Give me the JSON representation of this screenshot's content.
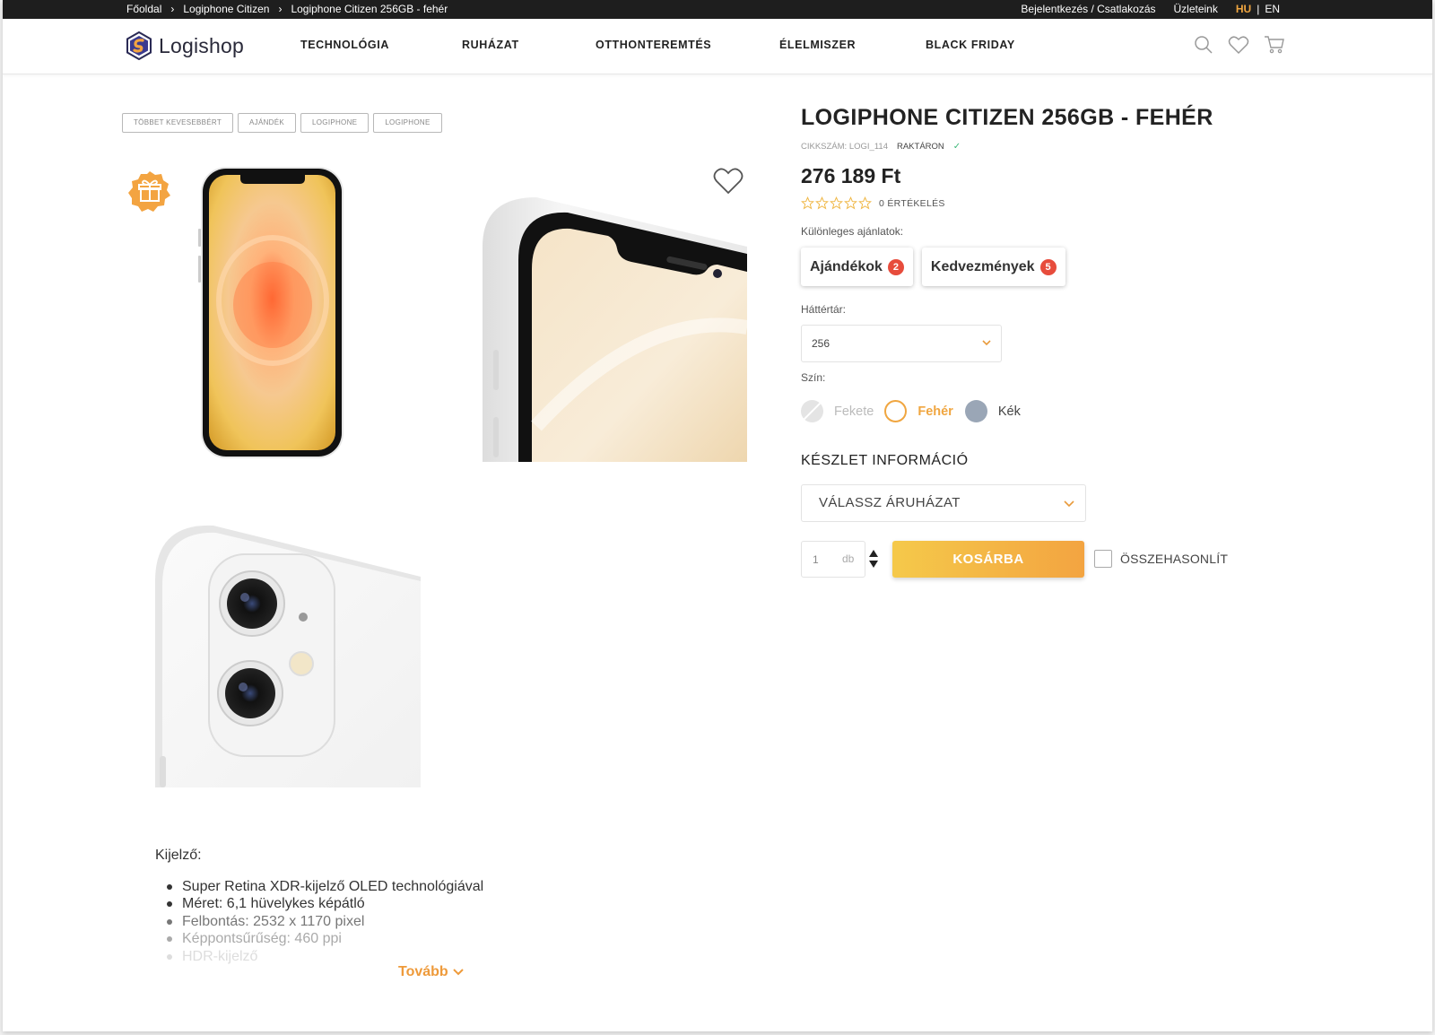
{
  "breadcrumb": [
    "Főoldal",
    "Logiphone Citizen",
    "Logiphone Citizen 256GB - fehér"
  ],
  "topbar": {
    "login": "Bejelentkezés / Csatlakozás",
    "stores": "Üzleteink",
    "lang_hu": "HU",
    "lang_sep": "|",
    "lang_en": "EN"
  },
  "logo": "Logishop",
  "nav": [
    "TECHNOLÓGIA",
    "RUHÁZAT",
    "OTTHONTEREMTÉS",
    "ÉLELMISZER",
    "BLACK FRIDAY"
  ],
  "header_icons": [
    "search-icon",
    "heart-icon",
    "cart-icon"
  ],
  "tags": [
    "TÖBBET KEVESEBBÉRT",
    "AJÁNDÉK",
    "LOGIPHONE",
    "LOGIPHONE"
  ],
  "product": {
    "title": "LOGIPHONE CITIZEN 256GB - FEHÉR",
    "sku": "CIKKSZÁM: LOGI_114",
    "stock_status": "RAKTÁRON",
    "price": "276 189 Ft",
    "rating_stars": 0,
    "rating_count": "0 ÉRTÉKELÉS",
    "offers_label": "Különleges ajánlatok:",
    "offers": [
      {
        "label": "Ajándékok",
        "count": "2"
      },
      {
        "label": "Kedvezmények",
        "count": "5"
      }
    ],
    "storage_label": "Háttértár:",
    "storage_value": "256",
    "color_label": "Szín:",
    "colors": [
      {
        "name": "Fekete",
        "state": "disabled"
      },
      {
        "name": "Fehér",
        "state": "selected"
      },
      {
        "name": "Kék",
        "state": "available"
      }
    ],
    "stock_info_title": "KÉSZLET INFORMÁCIÓ",
    "store_select": "VÁLASSZ ÁRUHÁZAT",
    "quantity": "1",
    "quantity_unit": "db",
    "add_to_cart": "KOSÁRBA",
    "compare": "ÖSSZEHASONLÍT"
  },
  "description": {
    "title": "Kijelző:",
    "items": [
      "Super Retina XDR-kijelző OLED technológiával",
      "Méret: 6,1 hüvelykes képátló",
      "Felbontás: 2532 x 1170 pixel",
      "Képpontsűrűség: 460 ppi",
      "HDR-kijelző"
    ],
    "more": "Tovább"
  },
  "colors": {
    "accent": "#f0a640",
    "badge": "#e74c3c",
    "topbar": "#1e1e1e",
    "stock_check": "#3cb878"
  }
}
